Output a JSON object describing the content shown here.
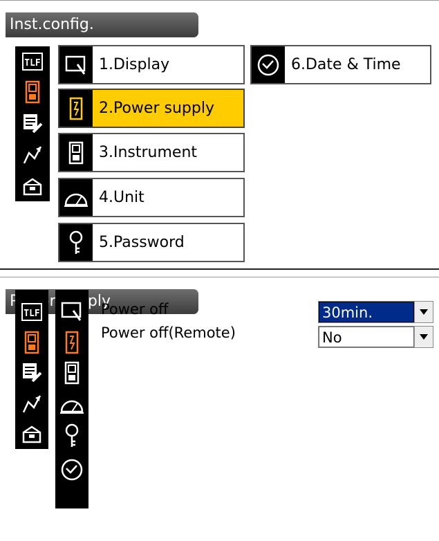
{
  "inst_config": {
    "title": "Inst.config.",
    "menu": [
      {
        "label": "1.Display",
        "icon": "display-icon",
        "active": false
      },
      {
        "label": "2.Power supply",
        "icon": "battery-icon",
        "active": true
      },
      {
        "label": "3.Instrument",
        "icon": "instrument-icon",
        "active": false
      },
      {
        "label": "4.Unit",
        "icon": "protractor-icon",
        "active": false
      },
      {
        "label": "5.Password",
        "icon": "key-icon",
        "active": false
      },
      {
        "label": "6.Date & Time",
        "icon": "clock-icon",
        "active": false
      }
    ]
  },
  "power_supply": {
    "title": "Power supply",
    "fields": [
      {
        "label": "Power off",
        "value": "30min."
      },
      {
        "label": "Power off(Remote)",
        "value": "No"
      }
    ]
  },
  "colors": {
    "active_highlight": "#ffcc00",
    "focused_field": "#002b8a",
    "battery_icon": "#ff7a1a"
  }
}
